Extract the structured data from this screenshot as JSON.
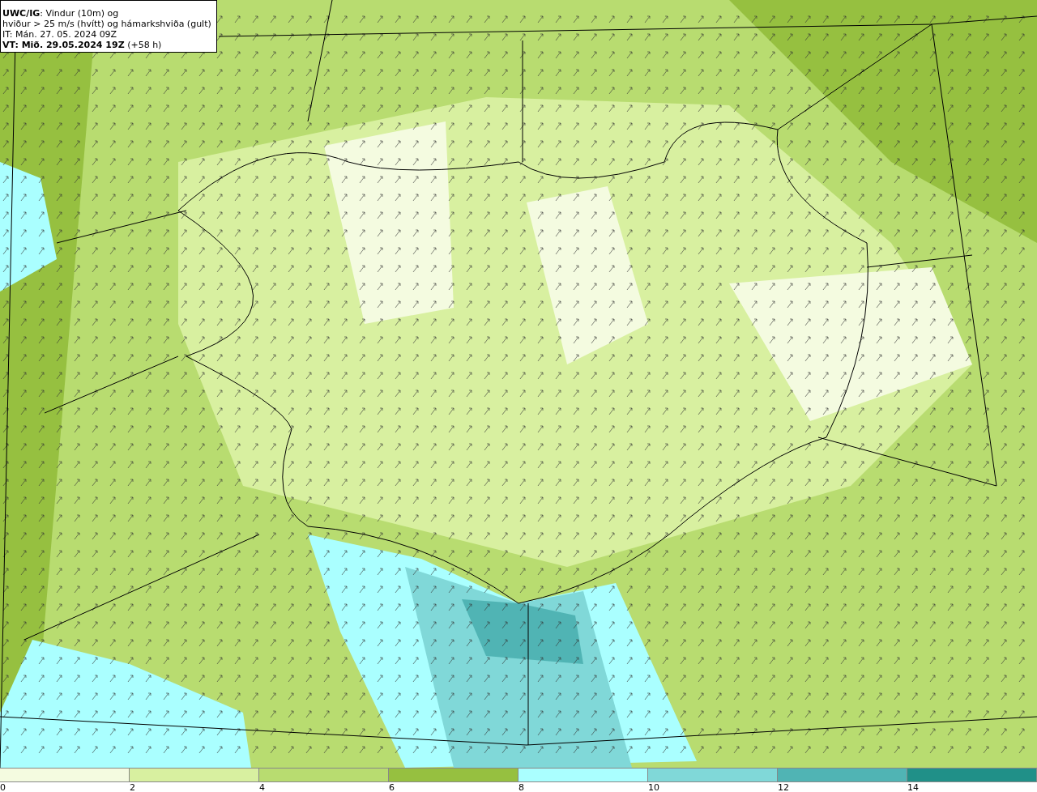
{
  "title_box": {
    "lines": [
      "**UWC/IG**: Vindur (10m) og",
      "hviður > 25 m/s (hvítt) og hámarkshviða (gult)",
      "IT: Mán. 27. 05. 2024 09Z",
      "**VT: Mið. 29.05.2024 19Z** (+58 h)"
    ]
  },
  "legend": [
    {
      "label": "0",
      "color": "#f4fbe0"
    },
    {
      "label": "2",
      "color": "#d8f0a0"
    },
    {
      "label": "4",
      "color": "#b8dc70"
    },
    {
      "label": "6",
      "color": "#96c040"
    },
    {
      "label": "8",
      "color": "#aaffff"
    },
    {
      "label": "10",
      "color": "#80d8d8"
    },
    {
      "label": "12",
      "color": "#50b4b4"
    },
    {
      "label": "14",
      "color": "#209088"
    }
  ]
}
